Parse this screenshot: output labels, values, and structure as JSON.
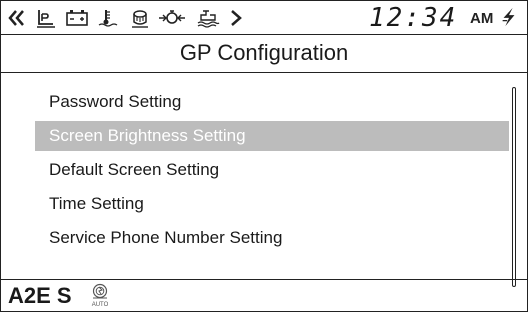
{
  "status_bar": {
    "icons": [
      "back-arrow-icon",
      "parking-brake-icon",
      "battery-icon",
      "coolant-temperature-icon",
      "engine-oil-icon",
      "engine-warning-icon",
      "water-in-fuel-icon",
      "forward-arrow-icon",
      "charging-lightning-icon"
    ],
    "clock_time": "12:34",
    "clock_ampm": "AM"
  },
  "title": "GP Configuration",
  "menu": {
    "items": [
      {
        "label": "Password Setting",
        "selected": false
      },
      {
        "label": "Screen Brightness Setting",
        "selected": true
      },
      {
        "label": "Default Screen Setting",
        "selected": false
      },
      {
        "label": "Time Setting",
        "selected": false
      },
      {
        "label": "Service Phone Number Setting",
        "selected": false
      }
    ]
  },
  "bottom_bar": {
    "mode_text": "A2E S",
    "auto_icon": "auto-engine-icon",
    "auto_label": "AUTO"
  },
  "colors": {
    "selection_background": "#bcbcbc",
    "selection_text": "#ffffff",
    "border": "#222222"
  }
}
